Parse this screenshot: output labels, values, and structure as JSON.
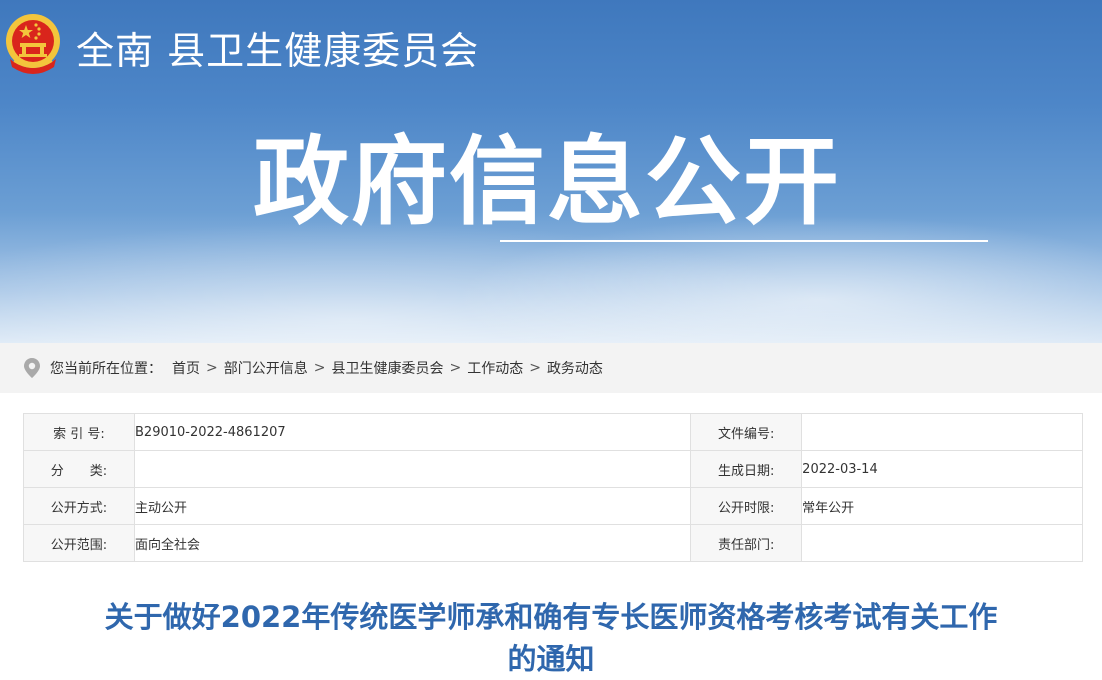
{
  "header": {
    "org_name": "全南 县卫生健康委员会",
    "banner_title": "政府信息公开"
  },
  "breadcrumb": {
    "prefix": "您当前所在位置：",
    "items": [
      "首页",
      "部门公开信息",
      "县卫生健康委员会",
      "工作动态",
      "政务动态"
    ],
    "separator": ">"
  },
  "meta": {
    "rows": [
      {
        "label1": "索 引 号:",
        "value1": "B29010-2022-4861207",
        "label2": "文件编号:",
        "value2": ""
      },
      {
        "label1": "分　　类:",
        "value1": "",
        "label2": "生成日期:",
        "value2": "2022-03-14"
      },
      {
        "label1": "公开方式:",
        "value1": "主动公开",
        "label2": "公开时限:",
        "value2": "常年公开"
      },
      {
        "label1": "公开范围:",
        "value1": "面向全社会",
        "label2": "责任部门:",
        "value2": ""
      }
    ]
  },
  "article": {
    "title_line1": "关于做好2022年传统医学师承和确有专长医师资格考核考试有关工作",
    "title_line2": "的通知"
  },
  "colors": {
    "banner_blue": "#3f78bd",
    "title_blue": "#2f67ad",
    "emblem_red": "#d9251c",
    "emblem_gold": "#f3c53c"
  },
  "icons": [
    "national-emblem-icon",
    "location-pin-icon"
  ]
}
